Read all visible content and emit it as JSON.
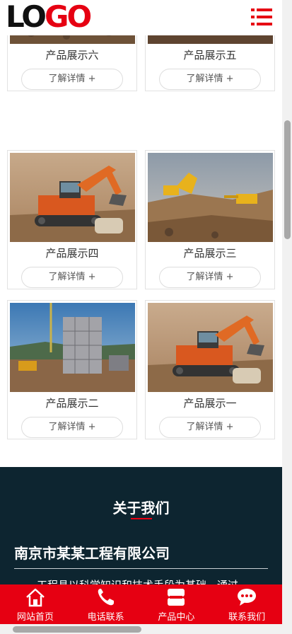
{
  "header": {
    "logo_part1": "LO",
    "logo_part2": "GO",
    "menu_icon": "menu-icon"
  },
  "products": [
    {
      "title": "产品展示六",
      "more": "了解详情 +",
      "scene": "earthworks"
    },
    {
      "title": "产品展示五",
      "more": "了解详情 +",
      "scene": "construction-tower"
    },
    {
      "title": "产品展示四",
      "more": "了解详情 +",
      "scene": "orange-excavator"
    },
    {
      "title": "产品展示三",
      "more": "了解详情 +",
      "scene": "yellow-excavators"
    },
    {
      "title": "产品展示二",
      "more": "了解详情 +",
      "scene": "construction-tower"
    },
    {
      "title": "产品展示一",
      "more": "了解详情 +",
      "scene": "orange-excavator"
    }
  ],
  "about": {
    "heading": "关于我们",
    "company": "南京市某某工程有限公司",
    "intro": "工程具以科学知识和技术手段为基础，通过"
  },
  "footer": [
    {
      "label": "网站首页",
      "icon": "home-icon"
    },
    {
      "label": "电话联系",
      "icon": "phone-icon"
    },
    {
      "label": "产品中心",
      "icon": "product-center-icon"
    },
    {
      "label": "联系我们",
      "icon": "chat-icon"
    }
  ],
  "colors": {
    "brand_red": "#e60012",
    "about_bg": "#0d2530"
  }
}
